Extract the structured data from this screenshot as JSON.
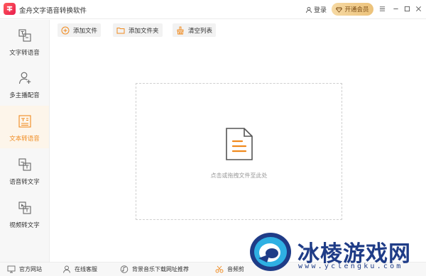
{
  "titlebar": {
    "title": "金舟文字语音转换软件",
    "login_label": "登录",
    "vip_label": "开通会员"
  },
  "sidebar": {
    "items": [
      {
        "label": "文字转语音",
        "icon": "text-to-speech-icon",
        "active": false
      },
      {
        "label": "多主播配音",
        "icon": "multi-host-icon",
        "active": false
      },
      {
        "label": "文本转语音",
        "icon": "doc-to-speech-icon",
        "active": true
      },
      {
        "label": "语音转文字",
        "icon": "speech-to-text-icon",
        "active": false
      },
      {
        "label": "视频转文字",
        "icon": "video-to-text-icon",
        "active": false
      }
    ]
  },
  "toolbar": {
    "add_file": "添加文件",
    "add_folder": "添加文件夹",
    "clear_list": "清空列表"
  },
  "dropzone": {
    "hint": "点击或拖拽文件至此处"
  },
  "footer": {
    "website": "官方网站",
    "support": "在线客服",
    "music": "背景音乐下载网址推荐",
    "audio_cut": "音频剪"
  },
  "watermark": {
    "title": "冰棱游戏网",
    "url": "www.yclengku.com"
  },
  "colors": {
    "accent": "#f08a1e",
    "vip_gold": "#ecc27a",
    "watermark_blue": "#1f3c87"
  }
}
